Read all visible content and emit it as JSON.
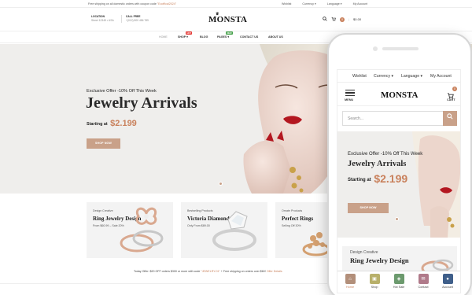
{
  "topbar": {
    "promo": "Free shipping on all domestic orders with coupon code",
    "promo_code": "\"Ecoffical2024\"",
    "wishlist": "Wishlist",
    "currency": "Currency ▾",
    "language": "Language ▾",
    "account": "My Account"
  },
  "header": {
    "location_label": "LOCATION",
    "location_value": "Street 12345 • USA",
    "call_label": "CALL FREE",
    "call_value": "+(012) 800 456 789",
    "logo": "MONSTA",
    "cart_count": "0",
    "cart_total": "$0.00"
  },
  "nav": {
    "items": [
      "HOME",
      "SHOP",
      "BLOG",
      "PAGES",
      "CONTACT US",
      "ABOUT US"
    ],
    "shop_badge": "HOT",
    "pages_badge": "NEW",
    "colors": {
      "hot": "#e53935",
      "new": "#43a047"
    }
  },
  "hero": {
    "subtitle": "Exclusive Offer -10% Off This Week",
    "title": "Jewelry Arrivals",
    "starting_label": "Starting at",
    "price": "$2.199",
    "button": "SHOP NOW"
  },
  "banners": [
    {
      "kicker": "Design Creative",
      "title": "Ring Jewelry Design",
      "sub": "From $60.99 – Sale 20%"
    },
    {
      "kicker": "Bestselling Products",
      "title": "Victoria Diamond",
      "sub": "Only From $89.00"
    },
    {
      "kicker": "Ornate Products",
      "title": "Perfect Rings",
      "sub": "Selling Off 30%"
    }
  ],
  "footer_note": {
    "text": "Today Offer: $20 OFF orders $300 or more with code",
    "code": "\"JEWELRY-01\"",
    "text2": "+ Free shipping on orders over $60!",
    "link": "Offer Details"
  },
  "mobile": {
    "topbar": {
      "wishlist": "Wishlist",
      "currency": "Currency ▾",
      "language": "Language ▾",
      "account": "My Account"
    },
    "menu_label": "MENU",
    "logo": "MONSTA",
    "cart_label": "CART",
    "cart_count": "0",
    "search_placeholder": "Search...",
    "hero": {
      "subtitle": "Exclusive Offer -10% Off This Week",
      "title": "Jewelry Arrivals",
      "starting_label": "Starting at",
      "price": "$2.199",
      "button": "SHOP NOW"
    },
    "banner": {
      "kicker": "Design Creative",
      "title": "Ring Jewelry Design"
    },
    "tabs": [
      {
        "label": "Home",
        "color": "#b28f7a"
      },
      {
        "label": "Shop",
        "color": "#b8b06a"
      },
      {
        "label": "Hot Sale",
        "color": "#6c9a6e"
      },
      {
        "label": "Contact",
        "color": "#b07a8a"
      },
      {
        "label": "Account",
        "color": "#3f5f8a"
      }
    ]
  },
  "colors": {
    "accent": "#c9815c",
    "button": "#c9a189"
  }
}
